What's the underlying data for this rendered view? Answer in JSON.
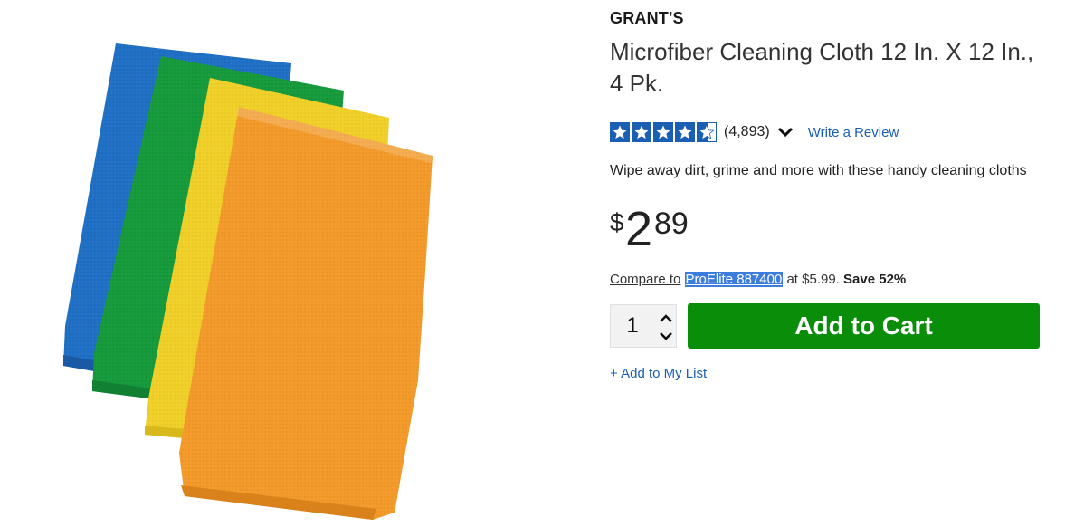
{
  "product": {
    "brand": "GRANT'S",
    "title": "Microfiber Cleaning Cloth 12 In. X 12 In., 4 Pk.",
    "image_alt": "Stack of blue, green, yellow and orange microfiber cloths",
    "rating": {
      "stars": 4.5,
      "count": "(4,893)",
      "write_review": "Write a Review"
    },
    "description": "Wipe away dirt, grime and more with these handy cleaning cloths",
    "price": {
      "symbol": "$",
      "whole": "2",
      "cents": "89"
    },
    "compare": {
      "prefix": "Compare to",
      "item": "ProElite 887400",
      "at_price": "at $5.99.",
      "save": "Save 52%"
    },
    "quantity": "1",
    "add_to_cart": "Add to Cart",
    "add_to_list": "+ Add to My List"
  },
  "colors": {
    "brand_blue": "#1a5fb4",
    "cart_green": "#0a8e0a",
    "highlight": "#3c7cdc"
  },
  "icons": [
    "star-icon",
    "chevron-down-icon",
    "caret-up-icon",
    "caret-down-icon"
  ]
}
